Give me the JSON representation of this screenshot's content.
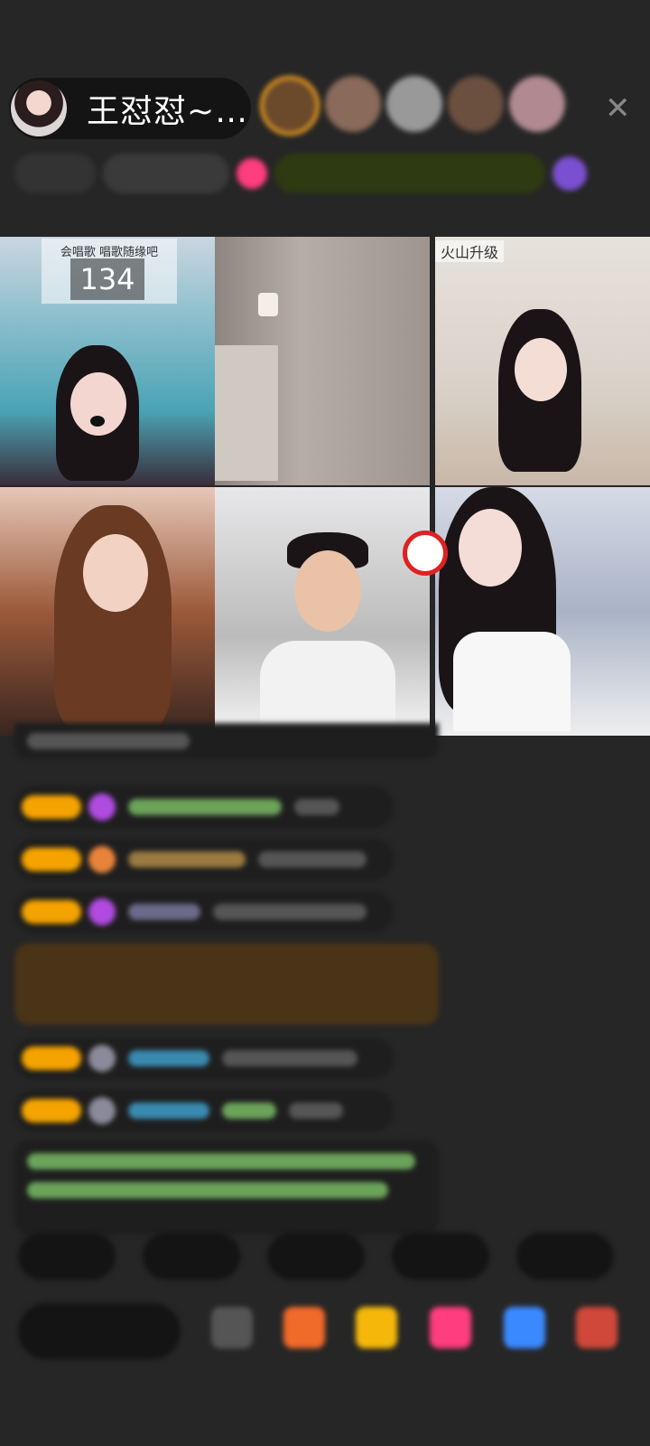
{
  "host": {
    "name": "王怼怼~…"
  },
  "tiles": {
    "t1": {
      "song_label": "会唱歌  唱歌随缘吧",
      "song_count": "134"
    },
    "t3": {
      "overlay": "火山升级"
    }
  },
  "colors": {
    "background": "#262626",
    "badge": "#f5a300",
    "accent_pink": "#ff3d7f",
    "chat_green": "#7ec86a",
    "highlight_bg": "#4a3418"
  },
  "icons": [
    "close-icon",
    "gem-icon",
    "gift-icon",
    "no-smoking-icon"
  ]
}
